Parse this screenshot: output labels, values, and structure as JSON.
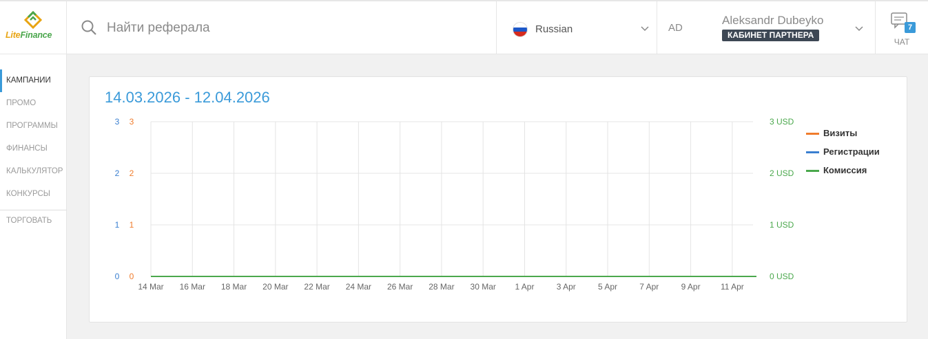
{
  "brand": {
    "lite": "Lite",
    "finance": "Finance"
  },
  "search": {
    "placeholder": "Найти реферала"
  },
  "language": {
    "selected": "Russian"
  },
  "user": {
    "initials": "AD",
    "name": "Aleksandr Dubeyko",
    "role_badge": "КАБИНЕТ ПАРТНЕРА"
  },
  "chat": {
    "label": "ЧАТ",
    "unread": "7"
  },
  "sidebar": {
    "items": [
      {
        "label": "КАМПАНИИ",
        "active": true
      },
      {
        "label": "ПРОМО"
      },
      {
        "label": "ПРОГРАММЫ"
      },
      {
        "label": "ФИНАНСЫ"
      },
      {
        "label": "КАЛЬКУЛЯТОР"
      },
      {
        "label": "КОНКУРСЫ"
      },
      {
        "label": "ТОРГОВАТЬ"
      }
    ]
  },
  "colors": {
    "accent": "#3a9ad9",
    "visits": "#f07c2c",
    "registrations": "#3a7fd0",
    "commission": "#4aa84c"
  },
  "chart_data": {
    "type": "line",
    "title": "14.03.2026 - 12.04.2026",
    "x_ticks": [
      "14 Mar",
      "16 Mar",
      "18 Mar",
      "20 Mar",
      "22 Mar",
      "24 Mar",
      "26 Mar",
      "28 Mar",
      "30 Mar",
      "1 Apr",
      "3 Apr",
      "5 Apr",
      "7 Apr",
      "9 Apr",
      "11 Apr"
    ],
    "y_left_registrations": {
      "ticks": [
        "0",
        "1",
        "2",
        "3"
      ],
      "range": [
        0,
        3
      ]
    },
    "y_left_visits": {
      "ticks": [
        "0",
        "1",
        "2",
        "3"
      ],
      "range": [
        0,
        3
      ]
    },
    "y_right_commission": {
      "ticks": [
        "0 USD",
        "1 USD",
        "2 USD",
        "3 USD"
      ],
      "range": [
        0,
        3
      ]
    },
    "grid": true,
    "legend_position": "right",
    "series": [
      {
        "name": "Визиты",
        "axis": "visits",
        "values": [
          0,
          0,
          0,
          0,
          0,
          0,
          0,
          0,
          0,
          0,
          0,
          0,
          0,
          0,
          0
        ]
      },
      {
        "name": "Регистрации",
        "axis": "registrations",
        "values": [
          0,
          0,
          0,
          0,
          0,
          0,
          0,
          0,
          0,
          0,
          0,
          0,
          0,
          0,
          0
        ]
      },
      {
        "name": "Комиссия",
        "axis": "commission",
        "values": [
          0,
          0,
          0,
          0,
          0,
          0,
          0,
          0,
          0,
          0,
          0,
          0,
          0,
          0,
          0
        ]
      }
    ]
  }
}
